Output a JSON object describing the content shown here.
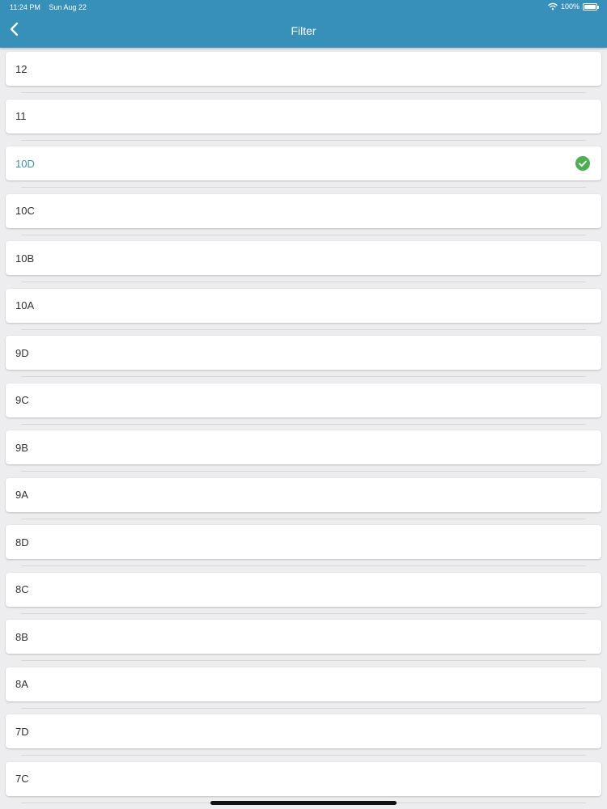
{
  "status_bar": {
    "time": "11:24 PM",
    "date": "Sun Aug 22",
    "battery": "100%"
  },
  "header": {
    "title": "Filter"
  },
  "filter_list": {
    "items": [
      {
        "label": "12",
        "selected": false
      },
      {
        "label": "11",
        "selected": false
      },
      {
        "label": "10D",
        "selected": true
      },
      {
        "label": "10C",
        "selected": false
      },
      {
        "label": "10B",
        "selected": false
      },
      {
        "label": "10A",
        "selected": false
      },
      {
        "label": "9D",
        "selected": false
      },
      {
        "label": "9C",
        "selected": false
      },
      {
        "label": "9B",
        "selected": false
      },
      {
        "label": "9A",
        "selected": false
      },
      {
        "label": "8D",
        "selected": false
      },
      {
        "label": "8C",
        "selected": false
      },
      {
        "label": "8B",
        "selected": false
      },
      {
        "label": "8A",
        "selected": false
      },
      {
        "label": "7D",
        "selected": false
      },
      {
        "label": "7C",
        "selected": false
      }
    ]
  },
  "colors": {
    "header": "#3690b9",
    "selected_text": "#3b93b6",
    "check": "#4caf50"
  },
  "icons": {
    "back": "chevron-left-icon",
    "selected": "check-circle-icon"
  }
}
